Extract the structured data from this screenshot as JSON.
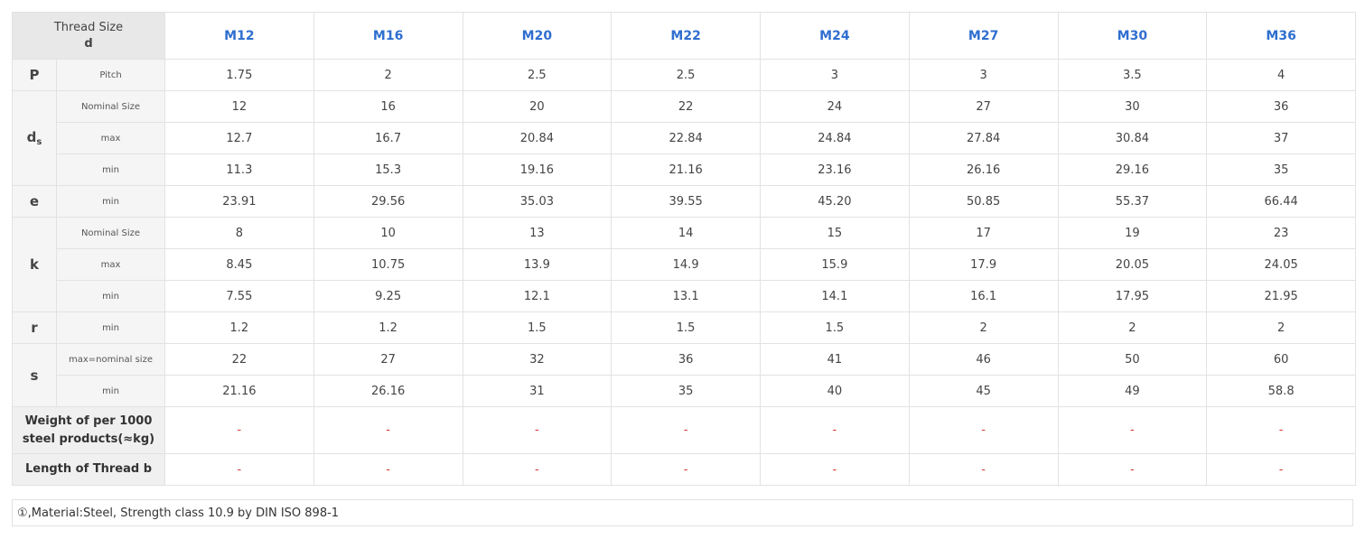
{
  "header": {
    "corner_line1": "Thread Size",
    "corner_line2": "d",
    "sizes": [
      "M12",
      "M16",
      "M20",
      "M22",
      "M24",
      "M27",
      "M30",
      "M36"
    ]
  },
  "groups": [
    {
      "symbol": "P",
      "symbol_sub": "",
      "rows": [
        {
          "label": "Pitch",
          "values": [
            "1.75",
            "2",
            "2.5",
            "2.5",
            "3",
            "3",
            "3.5",
            "4"
          ]
        }
      ]
    },
    {
      "symbol": "d",
      "symbol_sub": "s",
      "rows": [
        {
          "label": "Nominal Size",
          "values": [
            "12",
            "16",
            "20",
            "22",
            "24",
            "27",
            "30",
            "36"
          ]
        },
        {
          "label": "max",
          "values": [
            "12.7",
            "16.7",
            "20.84",
            "22.84",
            "24.84",
            "27.84",
            "30.84",
            "37"
          ]
        },
        {
          "label": "min",
          "values": [
            "11.3",
            "15.3",
            "19.16",
            "21.16",
            "23.16",
            "26.16",
            "29.16",
            "35"
          ]
        }
      ]
    },
    {
      "symbol": "e",
      "symbol_sub": "",
      "rows": [
        {
          "label": "min",
          "values": [
            "23.91",
            "29.56",
            "35.03",
            "39.55",
            "45.20",
            "50.85",
            "55.37",
            "66.44"
          ]
        }
      ]
    },
    {
      "symbol": "k",
      "symbol_sub": "",
      "rows": [
        {
          "label": "Nominal Size",
          "values": [
            "8",
            "10",
            "13",
            "14",
            "15",
            "17",
            "19",
            "23"
          ]
        },
        {
          "label": "max",
          "values": [
            "8.45",
            "10.75",
            "13.9",
            "14.9",
            "15.9",
            "17.9",
            "20.05",
            "24.05"
          ]
        },
        {
          "label": "min",
          "values": [
            "7.55",
            "9.25",
            "12.1",
            "13.1",
            "14.1",
            "16.1",
            "17.95",
            "21.95"
          ]
        }
      ]
    },
    {
      "symbol": "r",
      "symbol_sub": "",
      "rows": [
        {
          "label": "min",
          "values": [
            "1.2",
            "1.2",
            "1.5",
            "1.5",
            "1.5",
            "2",
            "2",
            "2"
          ]
        }
      ]
    },
    {
      "symbol": "s",
      "symbol_sub": "",
      "rows": [
        {
          "label": "max=nominal size",
          "values": [
            "22",
            "27",
            "32",
            "36",
            "41",
            "46",
            "50",
            "60"
          ]
        },
        {
          "label": "min",
          "values": [
            "21.16",
            "26.16",
            "31",
            "35",
            "40",
            "45",
            "49",
            "58.8"
          ]
        }
      ]
    }
  ],
  "footer_rows": [
    {
      "label_line1": "Weight of per 1000",
      "label_line2": "steel products(≈kg)",
      "values": [
        "-",
        "-",
        "-",
        "-",
        "-",
        "-",
        "-",
        "-"
      ]
    },
    {
      "label_line1": "Length of Thread b",
      "label_line2": "",
      "values": [
        "-",
        "-",
        "-",
        "-",
        "-",
        "-",
        "-",
        "-"
      ]
    }
  ],
  "note": "①,Material:Steel, Strength class 10.9 by DIN ISO 898-1",
  "colors": {
    "size_header": "#2f6ecf",
    "dash": "#d23a2e",
    "label_bg": "#f5f5f5",
    "corner_bg": "#e8e8e8"
  }
}
